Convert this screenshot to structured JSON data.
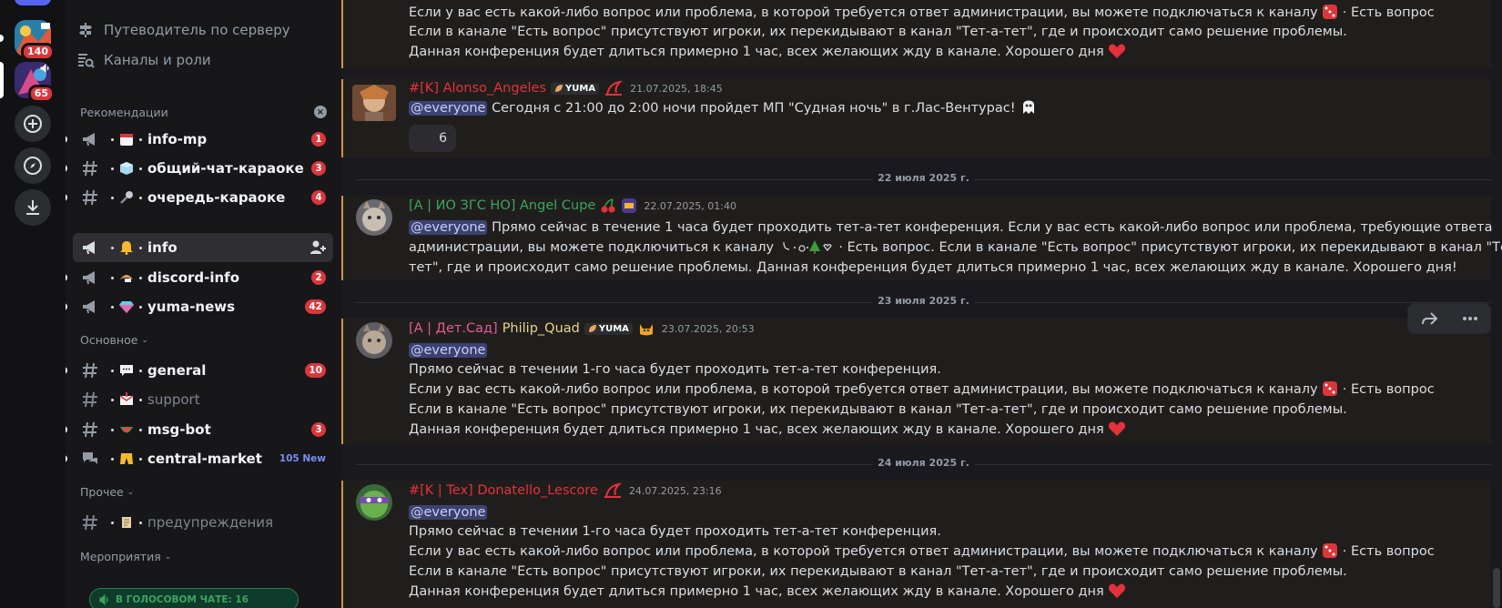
{
  "servers": {
    "srv1_count": "140",
    "srv2_count": "65"
  },
  "sidebar": {
    "server_guide": "Путеводитель по серверу",
    "channels_roles": "Каналы и роли",
    "cat_recommendations": "Рекомендации",
    "cat_main": "Основное",
    "cat_other": "Прочее",
    "cat_events": "Мероприятия",
    "channels": [
      {
        "name": "info-mp",
        "badge": "1"
      },
      {
        "name": "общий-чат-караоке",
        "badge": "3"
      },
      {
        "name": "очередь-караоке",
        "badge": "4"
      },
      {
        "name": "info",
        "badge": ""
      },
      {
        "name": "discord-info",
        "badge": "2"
      },
      {
        "name": "yuma-news",
        "badge": "42"
      },
      {
        "name": "general",
        "badge": "10"
      },
      {
        "name": "support",
        "badge": ""
      },
      {
        "name": "msg-bot",
        "badge": "3"
      },
      {
        "name": "central-market",
        "badge": "105 New"
      },
      {
        "name": "предупреждения",
        "badge": ""
      }
    ],
    "voice_bar": "В ГОЛОСОВОМ ЧАТЕ: 16"
  },
  "chat": {
    "msg0": {
      "line1": "Если у вас есть какой-либо вопрос или проблема, в которой требуется ответ администрации, вы можете подключаться к каналу",
      "line1_channel": "Есть вопрос",
      "line2": "Если в канале \"Есть вопрос\" присутствуют игроки, их перекидывают в канал \"Тет-а-тет\", где и происходит само решение проблемы.",
      "line3": "Данная конференция будет длиться примерно 1 час, всех желающих жду в канале. Хорошего дня"
    },
    "msg1": {
      "author": "#[K] Alonso_Angeles",
      "tag": "YUMA",
      "time": "21.07.2025, 18:45",
      "mention": "@everyone",
      "text": "Сегодня с 21:00 до 2:00 ночи пройдет МП \"Судная ночь\" в г.Лас-Вентурас!",
      "reaction_count": "6"
    },
    "date1": "22 июля 2025 г.",
    "msg2": {
      "author": "[A | ИО ЗГС НО] Angel Cupe",
      "time": "22.07.2025, 01:40",
      "mention": "@everyone",
      "line1": "Прямо сейчас в течение 1 часа будет проходить тет-а-тет конференция. Если у вас есть какой-либо вопрос или проблема, требующие ответа",
      "line2a": "администрации, вы можете подключиться к каналу",
      "line2b": "Есть вопрос. Если в канале \"Есть вопрос\" присутствуют игроки, их перекидывают в канал \"Тет-а-",
      "line3": "тет\", где и происходит само решение проблемы. Данная конференция будет длиться примерно 1 час, всех желающих жду в канале. Хорошего дня!"
    },
    "date2": "23 июля 2025 г.",
    "msg3": {
      "author_prefix": "[A | Дет.Сад]",
      "author_name": "Philip_Quad",
      "tag": "YUMA",
      "time": "23.07.2025, 20:53",
      "mention": "@everyone",
      "line1": "Прямо сейчас в течении 1-го часа будет проходить тет-а-тет конференция.",
      "line2": "Если у вас есть какой-либо вопрос или проблема, в которой требуется ответ администрации, вы можете подключаться к каналу",
      "line2_channel": "Есть вопрос",
      "line3": "Если в канале \"Есть вопрос\" присутствуют игроки, их перекидывают в канал \"Тет-а-тет\", где и происходит само решение проблемы.",
      "line4": "Данная конференция будет длиться примерно 1 час, всех желающих жду в канале. Хорошего дня"
    },
    "date3": "24 июля 2025 г.",
    "msg4": {
      "author": "#[K | Tex] Donatello_Lescore",
      "time": "24.07.2025, 23:16",
      "mention": "@everyone",
      "line1": "Прямо сейчас в течении 1-го часа будет проходить тет-а-тет конференция.",
      "line2": "Если у вас есть какой-либо вопрос или проблема, в которой требуется ответ администрации, вы можете подключаться к каналу",
      "line2_channel": "Есть вопрос",
      "line3": "Если в канале \"Есть вопрос\" присутствуют игроки, их перекидывают в канал \"Тет-а-тет\", где и происходит само решение проблемы.",
      "line4": "Данная конференция будет длиться примерно 1 час, всех желающих жду в канале. Хорошего дня"
    }
  },
  "colors": {
    "author_red": "#e4313c",
    "author_green": "#3ba55d",
    "mention_bg": "#3c4270",
    "accent": "#5865f2"
  }
}
